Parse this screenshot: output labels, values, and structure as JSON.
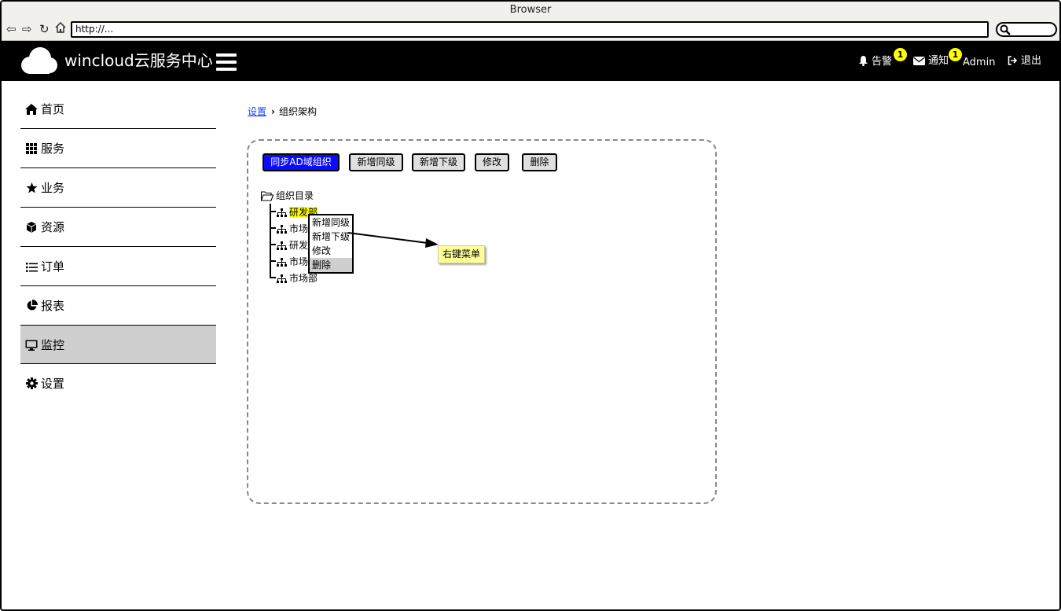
{
  "browser": {
    "window_title": "Browser",
    "url": "http://...",
    "nav_icons": [
      "back-icon",
      "forward-icon",
      "reload-icon",
      "home-icon"
    ]
  },
  "header": {
    "title": "wincloud云服务中心",
    "alerts": {
      "label": "告警",
      "count": "1"
    },
    "notifications": {
      "label": "通知",
      "count": "1"
    },
    "user": "Admin",
    "logout": "退出"
  },
  "sidebar": {
    "items": [
      {
        "label": "首页",
        "icon": "home-icon"
      },
      {
        "label": "服务",
        "icon": "grid-icon"
      },
      {
        "label": "业务",
        "icon": "star-icon"
      },
      {
        "label": "资源",
        "icon": "cube-icon"
      },
      {
        "label": "订单",
        "icon": "list-icon"
      },
      {
        "label": "报表",
        "icon": "pie-chart-icon"
      },
      {
        "label": "监控",
        "icon": "monitor-icon",
        "active": true
      },
      {
        "label": "设置",
        "icon": "gear-icon"
      }
    ]
  },
  "breadcrumb": {
    "parent": "设置",
    "current": "组织架构"
  },
  "toolbar": {
    "sync": "同步AD域组织",
    "add_sibling": "新增同级",
    "add_child": "新增下级",
    "edit": "修改",
    "delete": "删除"
  },
  "tree": {
    "root": "组织目录",
    "nodes": [
      "研发部",
      "市场",
      "研发",
      "市场",
      "市场部"
    ]
  },
  "context_menu": {
    "items": [
      "新增同级",
      "新增下级",
      "修改",
      "删除"
    ],
    "selected": "删除"
  },
  "annotation": "右键菜单",
  "colors": {
    "primary_button": "#0a0cff",
    "highlight": "#ffff00",
    "note": "#ffff99",
    "header_bg": "#000000"
  }
}
